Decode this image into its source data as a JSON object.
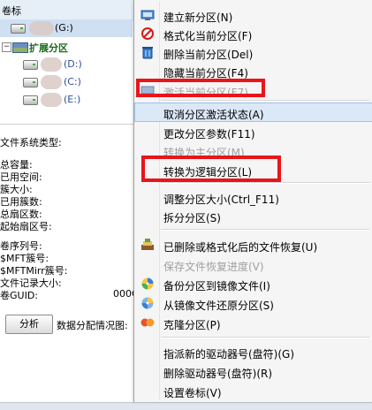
{
  "left_panel": {
    "header": "卷标",
    "tree": [
      {
        "label": "(G:)"
      },
      {
        "label": "扩展分区"
      },
      {
        "label": "(D:)"
      },
      {
        "label": "(C:)"
      },
      {
        "label": "(E:)"
      }
    ],
    "fs_type_label": "文件系统类型:",
    "stats": [
      "总容量:",
      "已用空间:",
      "簇大小:",
      "已用簇数:",
      "总扇区数:",
      "起始扇区号:"
    ],
    "details": [
      "卷序列号:",
      "$MFT簇号:",
      "$MFTMirr簇号:",
      "文件记录大小:",
      "卷GUID:"
    ],
    "guid_partial": "000C",
    "analyze_button": "分析",
    "distribution_label": "数据分配情况图:"
  },
  "menu": {
    "items": [
      {
        "label": "建立新分区(N)",
        "icon": "new-partition-icon",
        "enabled": true
      },
      {
        "label": "格式化当前分区(F)",
        "icon": "format-icon",
        "enabled": true
      },
      {
        "label": "删除当前分区(Del)",
        "icon": "trash-icon",
        "enabled": true
      },
      {
        "label": "隐藏当前分区(F4)",
        "icon": "",
        "enabled": true
      },
      {
        "label": "激活当前分区(F7)",
        "icon": "activate-icon",
        "enabled": false
      },
      {
        "label": "取消分区激活状态(A)",
        "icon": "",
        "enabled": true
      },
      {
        "label": "更改分区参数(F11)",
        "icon": "",
        "enabled": true
      },
      {
        "label": "转换为主分区(M)",
        "icon": "",
        "enabled": false
      },
      {
        "label": "转换为逻辑分区(L)",
        "icon": "",
        "enabled": true
      },
      {
        "label": "调整分区大小(Ctrl_F11)",
        "icon": "",
        "enabled": true
      },
      {
        "label": "拆分分区(S)",
        "icon": "",
        "enabled": true
      },
      {
        "label": "已删除或格式化后的文件恢复(U)",
        "icon": "recover-icon",
        "enabled": true
      },
      {
        "label": "保存文件恢复进度(V)",
        "icon": "",
        "enabled": false
      },
      {
        "label": "备份分区到镜像文件(I)",
        "icon": "backup-icon",
        "enabled": true
      },
      {
        "label": "从镜像文件还原分区(S)",
        "icon": "restore-icon",
        "enabled": true
      },
      {
        "label": "克隆分区(P)",
        "icon": "clone-icon",
        "enabled": true
      },
      {
        "label": "指派新的驱动器号(盘符)(G)",
        "icon": "",
        "enabled": true
      },
      {
        "label": "删除驱动器号(盘符)(R)",
        "icon": "",
        "enabled": true
      },
      {
        "label": "设置卷标(V)",
        "icon": "",
        "enabled": true
      }
    ]
  },
  "colors": {
    "highlight": "#dbe8f7",
    "annotation_box": "#e8151b",
    "disabled_text": "#a0a0a0"
  }
}
